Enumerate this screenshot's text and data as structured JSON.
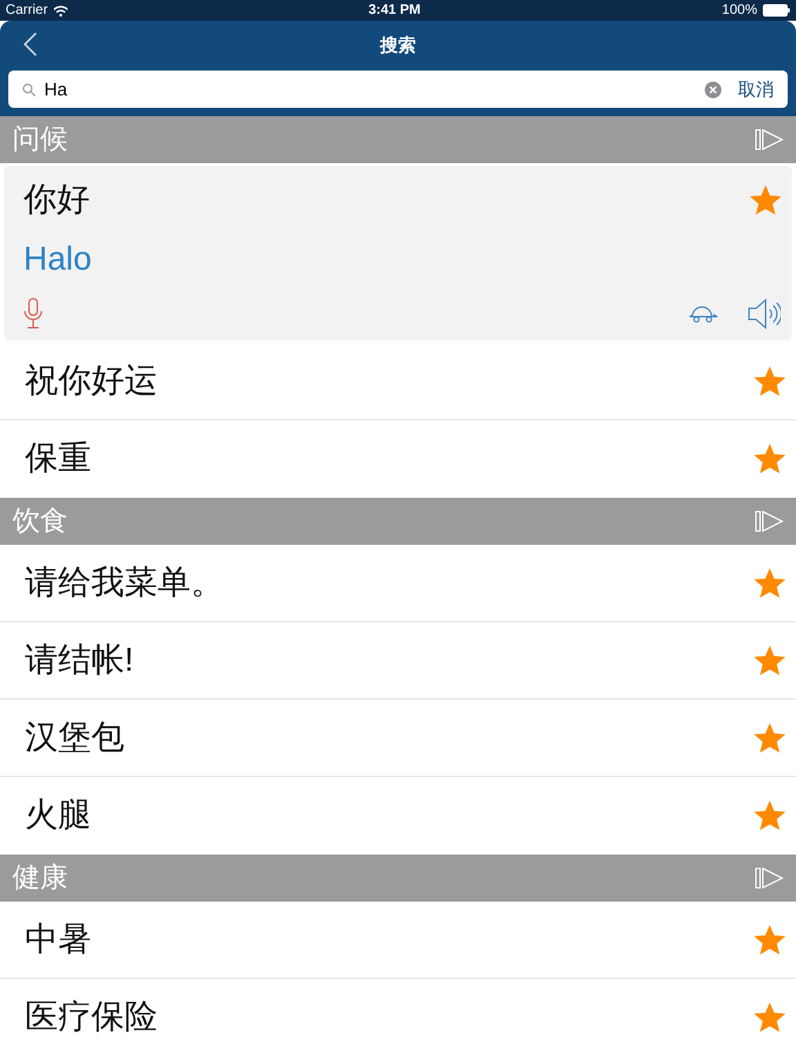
{
  "status_bar": {
    "carrier": "Carrier",
    "time": "3:41 PM",
    "battery": "100%"
  },
  "nav": {
    "title": "搜索"
  },
  "search": {
    "value": "Ha",
    "cancel": "取消"
  },
  "sections": [
    {
      "title": "问候",
      "items": [
        {
          "text": "你好",
          "translation": "Halo",
          "expanded": true,
          "starred": true
        },
        {
          "text": "祝你好运",
          "expanded": false,
          "starred": true
        },
        {
          "text": "保重",
          "expanded": false,
          "starred": true
        }
      ]
    },
    {
      "title": "饮食",
      "items": [
        {
          "text": "请给我菜单。",
          "expanded": false,
          "starred": true
        },
        {
          "text": "请结帐!",
          "expanded": false,
          "starred": true
        },
        {
          "text": "汉堡包",
          "expanded": false,
          "starred": true
        },
        {
          "text": "火腿",
          "expanded": false,
          "starred": true
        }
      ]
    },
    {
      "title": "健康",
      "items": [
        {
          "text": "中暑",
          "expanded": false,
          "starred": true
        },
        {
          "text": "医疗保险",
          "expanded": false,
          "starred": true
        }
      ]
    }
  ]
}
